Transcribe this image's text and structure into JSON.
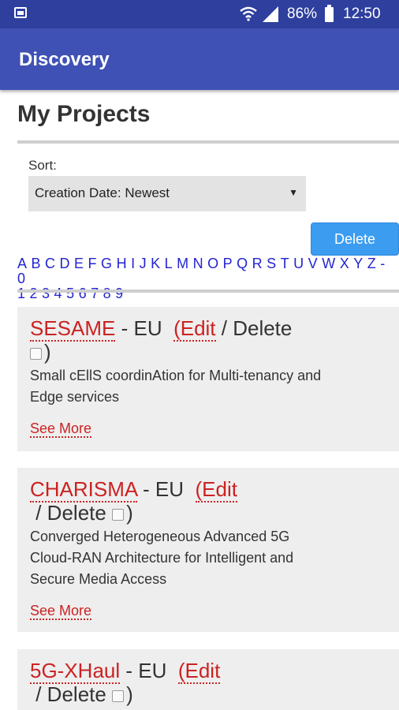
{
  "status_bar": {
    "battery": "86%",
    "time": "12:50",
    "icons": [
      "gallery-icon",
      "wifi-icon",
      "signal-icon",
      "battery-icon"
    ]
  },
  "app_bar": {
    "title": "Discovery"
  },
  "page": {
    "title": "My Projects"
  },
  "sort": {
    "label": "Sort:",
    "selected": "Creation Date: Newest"
  },
  "delete_button": "Delete",
  "alphabet": [
    "A",
    "B",
    "C",
    "D",
    "E",
    "F",
    "G",
    "H",
    "I",
    "J",
    "K",
    "L",
    "M",
    "N",
    "O",
    "P",
    "Q",
    "R",
    "S",
    "T",
    "U",
    "V",
    "W",
    "X",
    "Y",
    "Z",
    "-",
    "0",
    "1",
    "2",
    "3",
    "4",
    "5",
    "6",
    "7",
    "8",
    "9"
  ],
  "projects": [
    {
      "name": "SESAME",
      "region": "- EU",
      "edit": "(Edit",
      "delete": "/ Delete",
      "close": ")",
      "description": "Small cEllS coordinAtion for Multi-tenancy and Edge services",
      "see_more": "See More"
    },
    {
      "name": "CHARISMA",
      "region": "- EU",
      "edit": "(Edit",
      "delete": "/ Delete",
      "close": ")",
      "description": "Converged Heterogeneous Advanced 5G Cloud-RAN Architecture for Intelligent and Secure Media Access",
      "see_more": "See More"
    },
    {
      "name": "5G-XHaul",
      "region": "- EU",
      "edit": "(Edit",
      "delete": "/ Delete",
      "close": ")"
    }
  ]
}
